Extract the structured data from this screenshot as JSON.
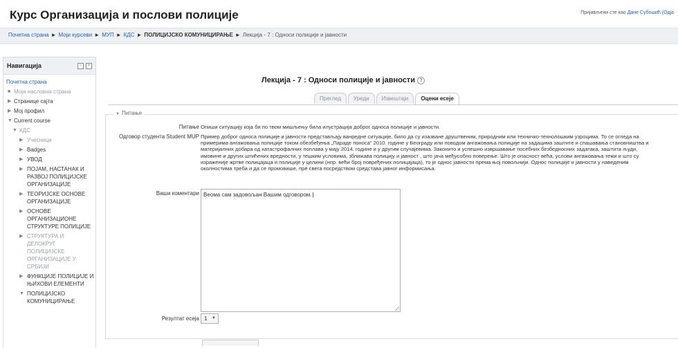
{
  "header": {
    "title": "Курс Организација и послови полиције"
  },
  "login": {
    "prefix": "Пријављени сте као",
    "user": "Дане Субошић (Одја"
  },
  "breadcrumb": {
    "items": [
      "Почетна страна",
      "Моји курсеви",
      "МУП",
      "КДС",
      "ПОЛИЦИЈСКО КОМУНИЦИРАЊЕ"
    ],
    "current": "Лекција - 7 : Односи полиције и јавности",
    "separator": "►"
  },
  "nav": {
    "title": "Навигација",
    "items": [
      {
        "label": "Почетна страна"
      },
      {
        "label": "Моја насловна страна"
      },
      {
        "label": "Странице сајта"
      },
      {
        "label": "Мој профил"
      },
      {
        "label": "Current course"
      },
      {
        "label": "КДС"
      },
      {
        "label": "Учесници"
      },
      {
        "label": "Badges"
      },
      {
        "label": "УВОД"
      },
      {
        "label": "ПОЈАМ, НАСТАНАК И РАЗВОЈ ПОЛИЦИЈСКЕ ОРГАНИЗАЦИЈЕ"
      },
      {
        "label": "ТЕОРИЈСКЕ ОСНОВЕ ОРГАНИЗАЦИЈЕ"
      },
      {
        "label": "ОСНОВЕ ОРГАНИЗАЦИОНЕ СТРУКТУРЕ ПОЛИЦИЈЕ"
      },
      {
        "label": "СТРУКТУРА И ДЕЛОКРУГ ПОЛИЦИЈСКЕ ОРГАНИЗАЦИЈЕ У СРБИЈИ"
      },
      {
        "label": "ФУНКЦИЈЕ ПОЛИЦИЈЕ И ЊИХОВИ ЕЛЕМЕНТИ"
      },
      {
        "label": "ПОЛИЦИЈСКО КОМУНИЦИРАЊЕ"
      }
    ]
  },
  "main": {
    "title": "Лекција - 7 : Односи полиције и јавности",
    "tabs": [
      "Преглед",
      "Уреди",
      "Извештаји",
      "Оцени есеје"
    ],
    "fieldset_legend": "Питање",
    "question_label": "Питање",
    "question_text": "Опиши ситуацију која би по твом мишљењу била илустрација доброг односа полиције и јавности.",
    "answer_label": "Одговор студента Student MUP",
    "answer_text": "Пример доброг односа полиције и јавности представљају ванредне ситуације, било да су изазване друштвеним, природним или техничко-технолошким узроцима. То се огледа на примерима ангажовања полиције током обезбеђења „Параде поноса“ 2010. године у Београду или поводом ангажовања полиције на задацима заштите и спашавања становништва и материјалних добара од катастрофалних поплава у мају 2014. године и у другим случајевима. Законито и успешно извршавање посебних безбедносних задатака, заштита људи, имовине и других штићених вредности, у тешким условима, зближава полицију и јавност , што јача међусобно поверење. Што је опасност већа, услови ангажовања тежи и што су израженије жртве полицајаца и полиције у целини (нпр. већи број повређених полицајаца), то је однос јавности према њој повољнији. Однос полиције и јавности у наведеним околностима треба и да се промовише, пре свега посредством средстава јавног информисања.",
    "comments_label": "Ваши коментари",
    "comments_value": "Веома сам задовољан Вашим одговором.",
    "grade_label": "Резултат есеја",
    "grade_value": "1"
  }
}
